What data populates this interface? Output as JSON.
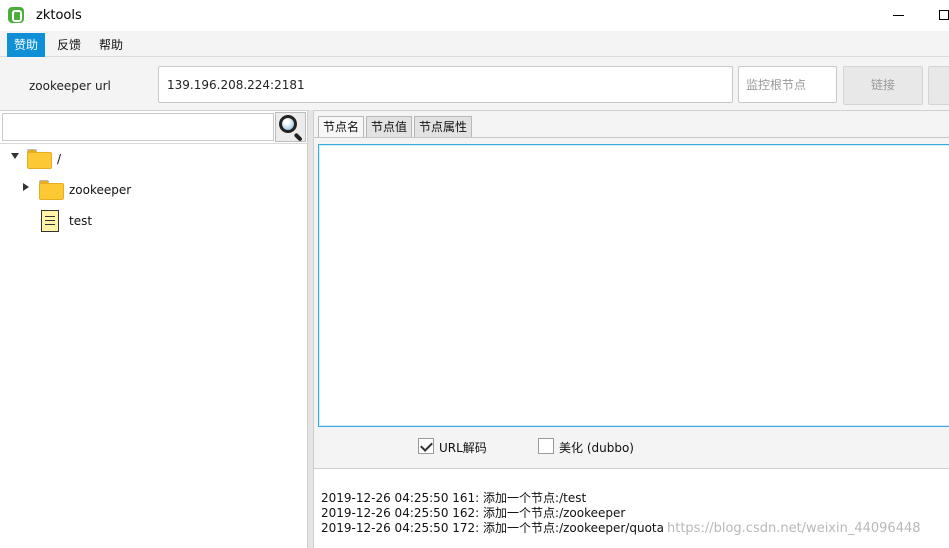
{
  "window": {
    "title": "zktools"
  },
  "menu": {
    "items": [
      "赞助",
      "反馈",
      "帮助"
    ],
    "active": "赞助"
  },
  "toolbar": {
    "url_label": "zookeeper url",
    "url_value": "139.196.208.224:2181",
    "root_placeholder": "监控根节点",
    "connect_label": "链接"
  },
  "tree": {
    "root": "/",
    "children": [
      "zookeeper",
      "test"
    ]
  },
  "tabs": [
    "节点名",
    "节点值",
    "节点属性"
  ],
  "options": {
    "url_decode": {
      "label": "URL解码",
      "checked": true
    },
    "beautify": {
      "label": "美化 (dubbo)",
      "checked": false
    }
  },
  "log": [
    "2019-12-26 04:25:50 161: 添加一个节点:/test",
    "2019-12-26 04:25:50 162: 添加一个节点:/zookeeper",
    "2019-12-26 04:25:50 172: 添加一个节点:/zookeeper/quota"
  ],
  "watermark": "https://blog.csdn.net/weixin_44096448",
  "colors": {
    "accent": "#0f8fd6",
    "editor_border": "#39a9de",
    "folder": "#fcc934"
  }
}
